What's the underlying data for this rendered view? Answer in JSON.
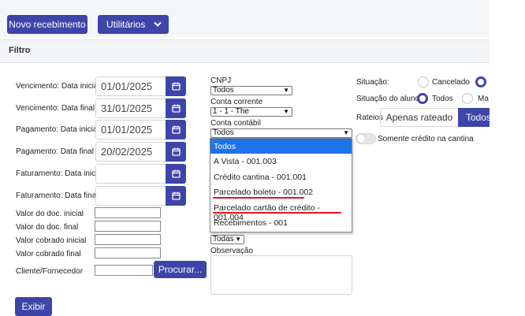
{
  "toolbar": {
    "new_receipt": "Novo recebimento",
    "utilities": "Utilitários"
  },
  "filter": {
    "title": "Filtro",
    "date_fields": [
      {
        "label": "Vencimento: Data inicial",
        "value": "01/01/2025"
      },
      {
        "label": "Vencimento: Data final",
        "value": "31/01/2025"
      },
      {
        "label": "Pagamento: Data inicial",
        "value": "01/01/2025"
      },
      {
        "label": "Pagamento: Data final",
        "value": "20/02/2025"
      },
      {
        "label": "Faturamento: Data inicial",
        "value": ""
      },
      {
        "label": "Faturamento: Data final",
        "value": ""
      }
    ],
    "value_fields": [
      {
        "label": "Valor do doc. inicial"
      },
      {
        "label": "Valor do doc. final"
      },
      {
        "label": "Valor cobrado inicial"
      },
      {
        "label": "Valor cobrado final"
      }
    ],
    "client_label": "Cliente/Fornecedor",
    "search_button": "Procurar...",
    "submit_button": "Exibir"
  },
  "middle": {
    "cnpj_label": "CNPJ",
    "cnpj_value": "Todos",
    "account_label": "Conta corrente",
    "account_value": "1 - 1 - The",
    "ledger_label": "Conta contábil",
    "ledger_value": "Todos",
    "ledger_options": [
      "Todos",
      "A Vista - 001.003",
      "Crédito cantina - 001.001",
      "Parcelado boleto - 001.002",
      "Parcelado cartão de crédito - 001.004",
      "Recebimentos - 001"
    ],
    "todas_value": "Todas",
    "observation_label": "Observação"
  },
  "right": {
    "status_label": "Situação:",
    "status_option_cancelled": "Cancelado",
    "student_status_label": "Situação do aluno:",
    "student_option_all": "Todos",
    "student_option_partial": "Ma",
    "rateios_label": "Rateios",
    "tab_only_apportioned": "Apenas rateado",
    "tab_all": "Todos",
    "canteen_credit_only": "Somente crédito na cantina"
  },
  "colors": {
    "primary": "#3d45a8",
    "dropdown_selected": "#1e73e8",
    "highlight_underline": "#e0141a"
  }
}
